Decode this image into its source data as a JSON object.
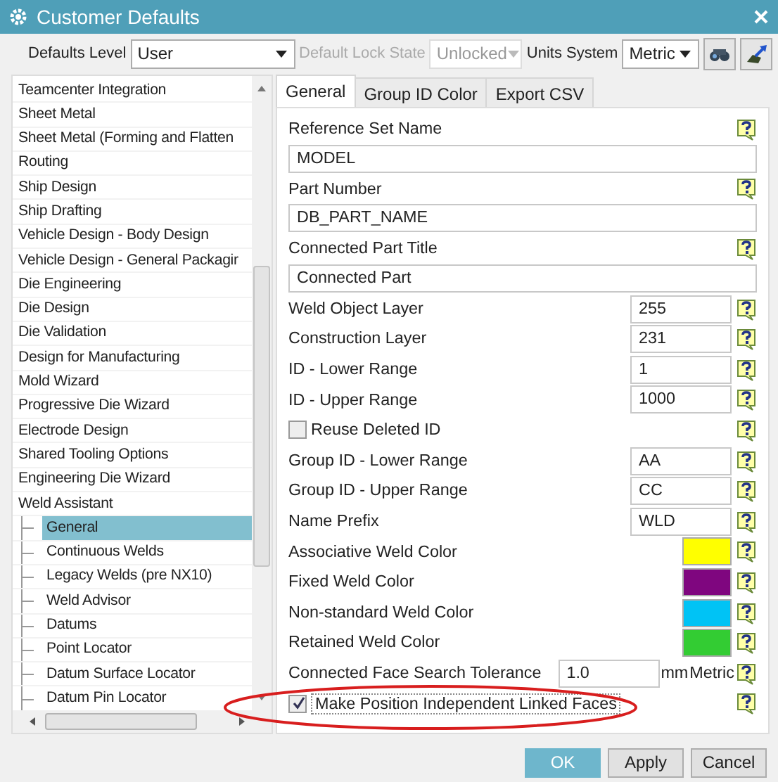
{
  "window": {
    "title": "Customer Defaults"
  },
  "toolbar": {
    "defaults_level": {
      "label": "Defaults Level",
      "value": "User",
      "disabled": false
    },
    "lock_state": {
      "label": "Default Lock State",
      "value": "Unlocked",
      "disabled": true
    },
    "units_system": {
      "label": "Units System",
      "value": "Metric",
      "disabled": false
    }
  },
  "tree": {
    "items": [
      {
        "label": "Teamcenter Integration",
        "selected": false
      },
      {
        "label": "Sheet Metal",
        "selected": false
      },
      {
        "label": "Sheet Metal (Forming and Flatten",
        "selected": false
      },
      {
        "label": "Routing",
        "selected": false
      },
      {
        "label": "Ship Design",
        "selected": false
      },
      {
        "label": "Ship Drafting",
        "selected": false
      },
      {
        "label": "Vehicle Design - Body Design",
        "selected": false
      },
      {
        "label": "Vehicle Design - General Packagir",
        "selected": false
      },
      {
        "label": "Die Engineering",
        "selected": false
      },
      {
        "label": "Die Design",
        "selected": false
      },
      {
        "label": "Die Validation",
        "selected": false
      },
      {
        "label": "Design for Manufacturing",
        "selected": false
      },
      {
        "label": "Mold Wizard",
        "selected": false
      },
      {
        "label": "Progressive Die Wizard",
        "selected": false
      },
      {
        "label": "Electrode Design",
        "selected": false
      },
      {
        "label": "Shared Tooling Options",
        "selected": false
      },
      {
        "label": "Engineering Die Wizard",
        "selected": false
      },
      {
        "label": "Weld Assistant",
        "selected": false,
        "children": [
          {
            "label": "General",
            "selected": true
          },
          {
            "label": "Continuous Welds",
            "selected": false
          },
          {
            "label": "Legacy Welds (pre NX10)",
            "selected": false
          },
          {
            "label": "Weld Advisor",
            "selected": false
          },
          {
            "label": "Datums",
            "selected": false
          },
          {
            "label": "Point Locator",
            "selected": false
          },
          {
            "label": "Datum Surface Locator",
            "selected": false
          },
          {
            "label": "Datum Pin Locator",
            "selected": false
          }
        ]
      }
    ]
  },
  "tabs": [
    {
      "label": "General",
      "selected": true
    },
    {
      "label": "Group ID Color",
      "selected": false
    },
    {
      "label": "Export CSV",
      "selected": false
    }
  ],
  "settings": [
    {
      "kind": "text",
      "label": "Reference Set Name",
      "value": "MODEL"
    },
    {
      "kind": "text",
      "label": "Part Number",
      "value": "DB_PART_NAME"
    },
    {
      "kind": "text",
      "label": "Connected Part Title",
      "value": "Connected Part"
    },
    {
      "kind": "number",
      "label": "Weld Object Layer",
      "value": "255"
    },
    {
      "kind": "number",
      "label": "Construction Layer",
      "value": "231"
    },
    {
      "kind": "number",
      "label": "ID - Lower Range",
      "value": "1"
    },
    {
      "kind": "number",
      "label": "ID - Upper Range",
      "value": "1000"
    },
    {
      "kind": "checkbox",
      "label": "Reuse Deleted ID",
      "checked": false
    },
    {
      "kind": "number",
      "label": "Group ID - Lower Range",
      "value": "AA"
    },
    {
      "kind": "number",
      "label": "Group ID - Upper Range",
      "value": "CC"
    },
    {
      "kind": "number",
      "label": "Name Prefix",
      "value": "WLD"
    },
    {
      "kind": "color",
      "label": "Associative Weld Color",
      "color": "#ffff00"
    },
    {
      "kind": "color",
      "label": "Fixed Weld Color",
      "color": "#7f067f"
    },
    {
      "kind": "color",
      "label": "Non-standard Weld Color",
      "color": "#00c3f5"
    },
    {
      "kind": "color",
      "label": "Retained Weld Color",
      "color": "#33cc33"
    },
    {
      "kind": "tolerance",
      "label": "Connected Face Search Tolerance",
      "value": "1.0",
      "unit": "mm",
      "system": "Metric"
    },
    {
      "kind": "checkbox",
      "label": "Make Position Independent Linked Faces",
      "checked": true
    }
  ],
  "buttons": [
    {
      "label": "OK",
      "primary": true
    },
    {
      "label": "Apply",
      "primary": false
    },
    {
      "label": "Cancel",
      "primary": false
    }
  ]
}
